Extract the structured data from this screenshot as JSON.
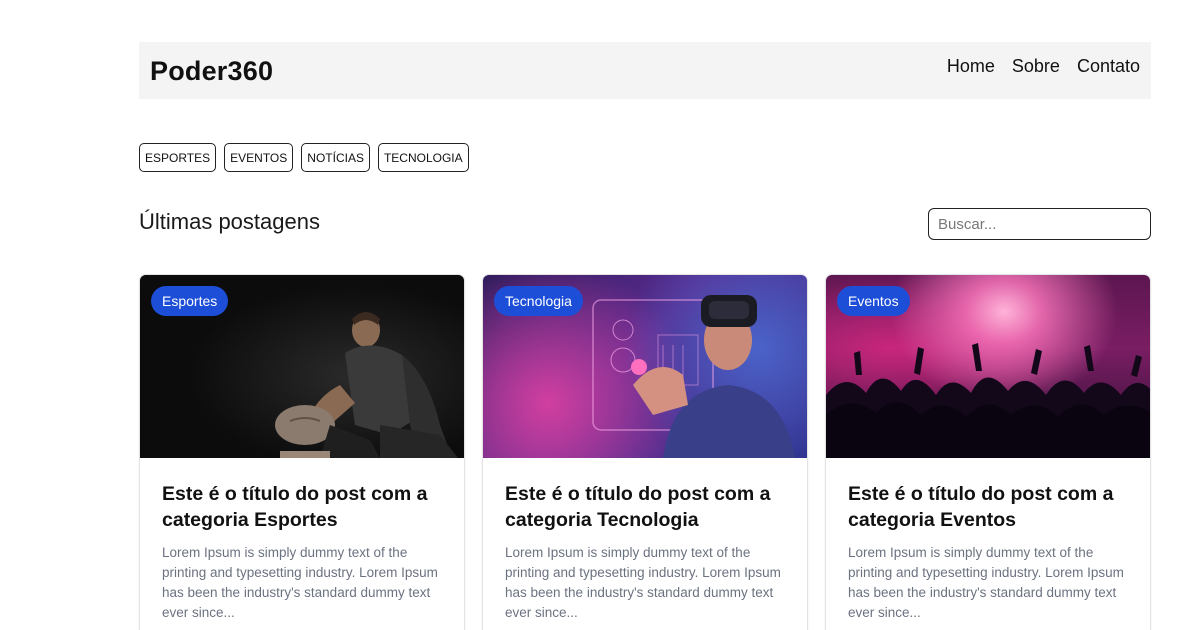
{
  "brand": "Poder360",
  "nav": [
    "Home",
    "Sobre",
    "Contato"
  ],
  "categories": [
    "ESPORTES",
    "EVENTOS",
    "NOTÍCIAS",
    "TECNOLOGIA"
  ],
  "section_title": "Últimas postagens",
  "search": {
    "placeholder": "Buscar..."
  },
  "colors": {
    "accent": "#1d4ed8",
    "header_bg": "#f4f4f4",
    "muted_text": "#6b7280"
  },
  "posts": [
    {
      "badge": "Esportes",
      "image": "athlete-with-ball-photo",
      "title": "Este é o título do post com a categoria Esportes",
      "excerpt": "Lorem Ipsum is simply dummy text of the printing and typesetting industry. Lorem Ipsum has been the industry's standard dummy text ever since..."
    },
    {
      "badge": "Tecnologia",
      "image": "vr-headset-photo",
      "title": "Este é o título do post com a categoria Tecnologia",
      "excerpt": "Lorem Ipsum is simply dummy text of the printing and typesetting industry. Lorem Ipsum has been the industry's standard dummy text ever since..."
    },
    {
      "badge": "Eventos",
      "image": "concert-crowd-photo",
      "title": "Este é o título do post com a categoria Eventos",
      "excerpt": "Lorem Ipsum is simply dummy text of the printing and typesetting industry. Lorem Ipsum has been the industry's standard dummy text ever since..."
    }
  ]
}
